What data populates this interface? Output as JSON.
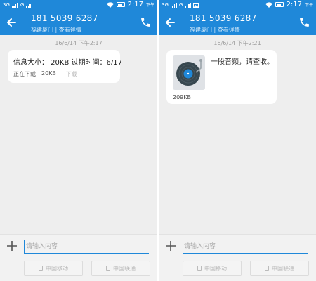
{
  "status_bar": {
    "left_network": "3G",
    "left_network2": "G",
    "time": "2:17",
    "ampm": "下午"
  },
  "header": {
    "contact_number": "181 5039 6287",
    "subtitle": "福建厦门 | 查看详情"
  },
  "left_screen": {
    "timestamp": "16/6/14 下午2:17",
    "mms_info": "信息大小：  20KB 过期时间：6/17",
    "status": "正在下载",
    "size": "20KB",
    "download_label": "下载"
  },
  "right_screen": {
    "timestamp": "16/6/14 下午2:21",
    "message_text": "一段音频，请查收。",
    "attachment_size": "209KB"
  },
  "composer": {
    "placeholder": "请输入内容",
    "sim1_label": "中国移动",
    "sim2_label": "中国联通"
  },
  "colors": {
    "accent": "#1f88d9",
    "background": "#eeeeee",
    "bubble": "#ffffff"
  },
  "icons": [
    "back-arrow-icon",
    "phone-icon",
    "plus-icon",
    "sim-card-icon",
    "wifi-icon",
    "battery-icon",
    "signal-icon",
    "vinyl-record-icon",
    "image-icon"
  ]
}
